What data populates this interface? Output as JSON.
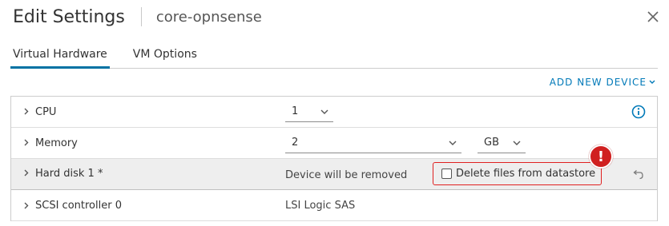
{
  "dialog": {
    "title": "Edit Settings",
    "subtitle": "core-opnsense"
  },
  "tabs": [
    {
      "label": "Virtual Hardware",
      "active": true
    },
    {
      "label": "VM Options",
      "active": false
    }
  ],
  "add_device": {
    "label": "ADD NEW DEVICE"
  },
  "rows": {
    "cpu": {
      "label": "CPU",
      "value": "1"
    },
    "memory": {
      "label": "Memory",
      "value": "2",
      "unit": "GB"
    },
    "hard_disk": {
      "label": "Hard disk 1 *",
      "status": "Device will be removed",
      "delete_label": "Delete files from datastore",
      "delete_checked": false,
      "alert": "!"
    },
    "scsi": {
      "label": "SCSI controller 0",
      "value": "LSI Logic SAS"
    }
  },
  "colors": {
    "accent": "#0072a3",
    "link": "#0079b8",
    "alert": "#d01f1f"
  },
  "icons": [
    "close-icon",
    "chevron-right-icon",
    "chevron-down-icon",
    "info-icon",
    "undo-icon",
    "alert-icon"
  ]
}
